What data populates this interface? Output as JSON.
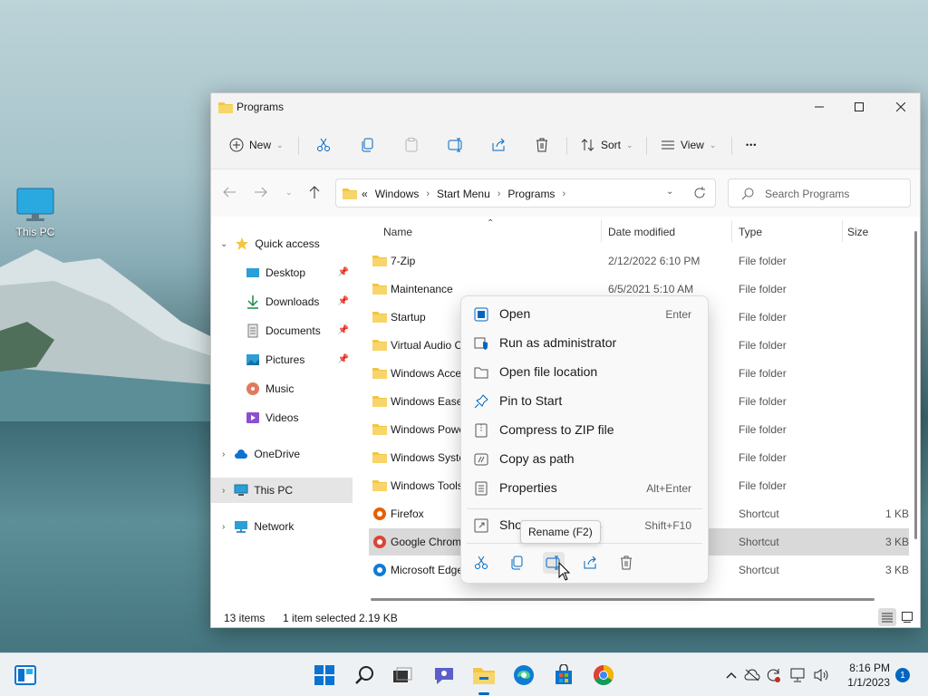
{
  "desktop": {
    "this_pc_label": "This PC"
  },
  "window": {
    "title": "Programs",
    "controls": {
      "minimize": "minimize",
      "maximize": "maximize",
      "close": "close"
    }
  },
  "toolbar": {
    "new_label": "New",
    "sort_label": "Sort",
    "view_label": "View",
    "more": "•••"
  },
  "address": {
    "prefix": "«",
    "crumbs": [
      "Windows",
      "Start Menu",
      "Programs"
    ],
    "search_placeholder": "Search Programs"
  },
  "sidebar": {
    "items": [
      {
        "label": "Quick access"
      },
      {
        "label": "Desktop"
      },
      {
        "label": "Downloads"
      },
      {
        "label": "Documents"
      },
      {
        "label": "Pictures"
      },
      {
        "label": "Music"
      },
      {
        "label": "Videos"
      },
      {
        "label": "OneDrive"
      },
      {
        "label": "This PC"
      },
      {
        "label": "Network"
      }
    ]
  },
  "list": {
    "headers": {
      "name": "Name",
      "date": "Date modified",
      "type": "Type",
      "size": "Size"
    },
    "rows": [
      {
        "name": "7-Zip",
        "date": "2/12/2022 6:10 PM",
        "type": "File folder",
        "size": ""
      },
      {
        "name": "Maintenance",
        "date": "6/5/2021 5:10 AM",
        "type": "File folder",
        "size": ""
      },
      {
        "name": "Startup",
        "date": "",
        "type": "File folder",
        "size": ""
      },
      {
        "name": "Virtual Audio C",
        "date": "",
        "type": "File folder",
        "size": ""
      },
      {
        "name": "Windows Acce",
        "date": "",
        "type": "File folder",
        "size": ""
      },
      {
        "name": "Windows Ease",
        "date": "",
        "type": "File folder",
        "size": ""
      },
      {
        "name": "Windows Powe",
        "date": "",
        "type": "File folder",
        "size": ""
      },
      {
        "name": "Windows Syste",
        "date": "",
        "type": "File folder",
        "size": ""
      },
      {
        "name": "Windows Tools",
        "date": "",
        "type": "File folder",
        "size": ""
      },
      {
        "name": "Firefox",
        "date": "",
        "type": "Shortcut",
        "size": "1 KB"
      },
      {
        "name": "Google Chrom",
        "date": "",
        "type": "Shortcut",
        "size": "3 KB"
      },
      {
        "name": "Microsoft Edge",
        "date": "",
        "type": "Shortcut",
        "size": "3 KB"
      }
    ]
  },
  "status": {
    "count": "13 items",
    "selected": "1 item selected",
    "size": "2.19 KB"
  },
  "context_menu": {
    "items": [
      {
        "label": "Open",
        "key": "Enter"
      },
      {
        "label": "Run as administrator",
        "key": ""
      },
      {
        "label": "Open file location",
        "key": ""
      },
      {
        "label": "Pin to Start",
        "key": ""
      },
      {
        "label": "Compress to ZIP file",
        "key": ""
      },
      {
        "label": "Copy as path",
        "key": ""
      },
      {
        "label": "Properties",
        "key": "Alt+Enter"
      }
    ],
    "more": {
      "label_start": "Sho",
      "label_end": "ns",
      "key": "Shift+F10"
    },
    "tooltip": "Rename (F2)"
  },
  "taskbar": {
    "time": "8:16 PM",
    "date": "1/1/2023",
    "notifications": "1"
  },
  "colors": {
    "accent": "#0067c0",
    "folder": "#f4c542",
    "selection": "#d9d9d9"
  },
  "icons": {
    "cut": "scissors-icon",
    "copy": "copy-icon",
    "paste": "paste-icon",
    "rename": "rename-icon",
    "share": "share-icon",
    "delete": "trash-icon"
  }
}
